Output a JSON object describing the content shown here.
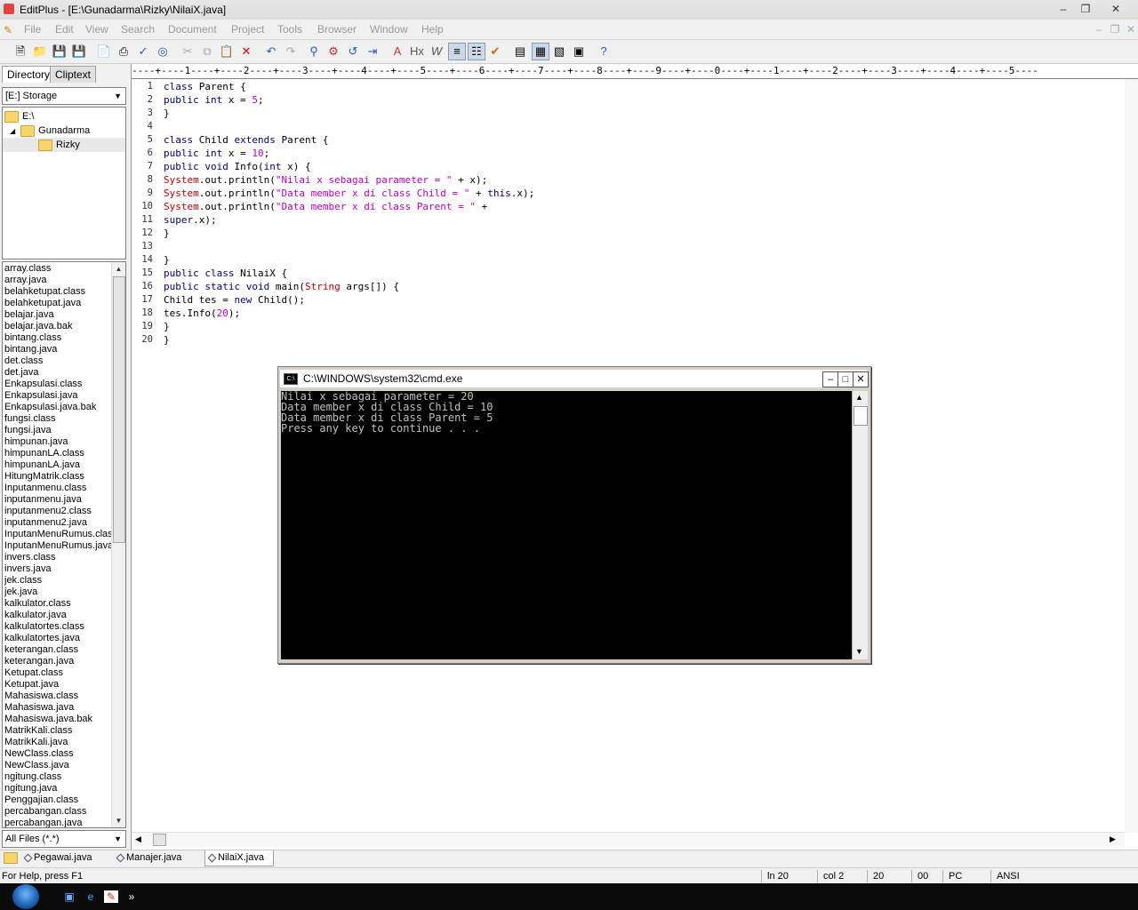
{
  "window": {
    "title": "EditPlus - [E:\\Gunadarma\\Rizky\\NilaiX.java]"
  },
  "menu": [
    "File",
    "Edit",
    "View",
    "Search",
    "Document",
    "Project",
    "Tools",
    "Browser",
    "Window",
    "Help"
  ],
  "left": {
    "tabs": [
      "Directory",
      "Cliptext"
    ],
    "drive": "[E:] Storage",
    "tree": [
      "E:\\",
      "Gunadarma",
      "Rizky"
    ],
    "files": [
      "array.class",
      "array.java",
      "belahketupat.class",
      "belahketupat.java",
      "belajar.java",
      "belajar.java.bak",
      "bintang.class",
      "bintang.java",
      "det.class",
      "det.java",
      "Enkapsulasi.class",
      "Enkapsulasi.java",
      "Enkapsulasi.java.bak",
      "fungsi.class",
      "fungsi.java",
      "himpunan.java",
      "himpunanLA.class",
      "himpunanLA.java",
      "HitungMatrik.class",
      "Inputanmenu.class",
      "inputanmenu.java",
      "inputanmenu2.class",
      "inputanmenu2.java",
      "InputanMenuRumus.class",
      "InputanMenuRumus.java",
      "invers.class",
      "invers.java",
      "jek.class",
      "jek.java",
      "kalkulator.class",
      "kalkulator.java",
      "kalkulatortes.class",
      "kalkulatortes.java",
      "keterangan.class",
      "keterangan.java",
      "Ketupat.class",
      "Ketupat.java",
      "Mahasiswa.class",
      "Mahasiswa.java",
      "Mahasiswa.java.bak",
      "MatrikKali.class",
      "MatrikKali.java",
      "NewClass.class",
      "NewClass.java",
      "ngitung.class",
      "ngitung.java",
      "Penggajian.class",
      "percabangan.class",
      "percabangan.java"
    ],
    "filter": "All Files (*.*)"
  },
  "editor": {
    "ruler": "----+----1----+----2----+----3----+----4----+----5----+----6----+----7----+----8----+----9----+----0----+----1----+----2----+----3----+----4----+----5----",
    "line_numbers": [
      "1",
      "2",
      "3",
      "4",
      "5",
      "6",
      "7",
      "8",
      "9",
      "10",
      "11",
      "12",
      "13",
      "14",
      "15",
      "16",
      "17",
      "18",
      "19",
      "20"
    ],
    "lines": [
      "class Parent {",
      "public int x = 5;",
      "}",
      "",
      "class Child extends Parent {",
      "public int x = 10;",
      "public void Info(int x) {",
      "System.out.println(\"Nilai x sebagai parameter = \" + x);",
      "System.out.println(\"Data member x di class Child = \" + this.x);",
      "System.out.println(\"Data member x di class Parent = \" +",
      "super.x);",
      "}",
      "",
      "}",
      "public class NilaiX {",
      "public static void main(String args[]) {",
      "Child tes = new Child();",
      "tes.Info(20);",
      "}",
      "}"
    ]
  },
  "cmd": {
    "title": "C:\\WINDOWS\\system32\\cmd.exe",
    "output": [
      "Nilai x sebagai parameter = 20",
      "Data member x di class Child = 10",
      "Data member x di class Parent = 5",
      "Press any key to continue . . ."
    ]
  },
  "doc_tabs": [
    "Pegawai.java",
    "Manajer.java",
    "NilaiX.java"
  ],
  "status": {
    "help": "For Help, press F1",
    "ln": "ln 20",
    "col": "col 2",
    "v1": "20",
    "v2": "00",
    "mode": "PC",
    "enc": "ANSI"
  },
  "colors": {
    "keyword": "#000080",
    "string": "#c000c0",
    "class_name": "#c00000",
    "console_bg": "#000000"
  }
}
